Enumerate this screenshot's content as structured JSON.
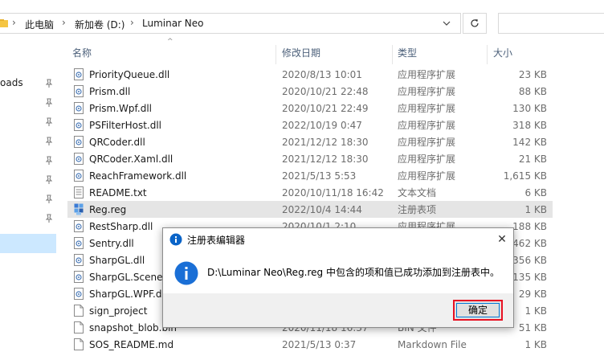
{
  "address": {
    "crumbs": [
      "此电脑",
      "新加卷 (D:)",
      "Luminar Neo"
    ],
    "separator": "›"
  },
  "nav": {
    "partial_label": "oads"
  },
  "columns": {
    "name": "名称",
    "modified": "修改日期",
    "type": "类型",
    "size": "大小"
  },
  "files": [
    {
      "name": "PriorityQueue.dll",
      "modified": "2020/8/13 10:01",
      "type": "应用程序扩展",
      "size": "23 KB",
      "icon": "dll-icon"
    },
    {
      "name": "Prism.dll",
      "modified": "2020/10/21 22:48",
      "type": "应用程序扩展",
      "size": "88 KB",
      "icon": "dll-icon"
    },
    {
      "name": "Prism.Wpf.dll",
      "modified": "2020/10/21 22:49",
      "type": "应用程序扩展",
      "size": "130 KB",
      "icon": "dll-icon"
    },
    {
      "name": "PSFilterHost.dll",
      "modified": "2022/10/19 0:47",
      "type": "应用程序扩展",
      "size": "318 KB",
      "icon": "dll-icon"
    },
    {
      "name": "QRCoder.dll",
      "modified": "2021/12/12 18:30",
      "type": "应用程序扩展",
      "size": "142 KB",
      "icon": "dll-icon"
    },
    {
      "name": "QRCoder.Xaml.dll",
      "modified": "2021/12/12 18:30",
      "type": "应用程序扩展",
      "size": "21 KB",
      "icon": "dll-icon"
    },
    {
      "name": "ReachFramework.dll",
      "modified": "2021/5/13 5:53",
      "type": "应用程序扩展",
      "size": "1,615 KB",
      "icon": "dll-icon"
    },
    {
      "name": "README.txt",
      "modified": "2020/10/11/18 16:42",
      "type": "文本文档",
      "size": "6 KB",
      "icon": "txt-icon"
    },
    {
      "name": "Reg.reg",
      "modified": "2022/10/4 14:44",
      "type": "注册表项",
      "size": "1 KB",
      "icon": "reg-icon",
      "selected": true
    },
    {
      "name": "RestSharp.dll",
      "modified": "2020/10/1 2:10",
      "type": "应用程序扩展",
      "size": "188 KB",
      "icon": "dll-icon"
    },
    {
      "name": "Sentry.dll",
      "modified": "",
      "type": "",
      "size": "462 KB",
      "icon": "dll-icon"
    },
    {
      "name": "SharpGL.dll",
      "modified": "",
      "type": "",
      "size": "356 KB",
      "icon": "dll-icon"
    },
    {
      "name": "SharpGL.SceneG",
      "modified": "",
      "type": "",
      "size": "135 KB",
      "icon": "dll-icon"
    },
    {
      "name": "SharpGL.WPF.dl",
      "modified": "",
      "type": "",
      "size": "29 KB",
      "icon": "dll-icon"
    },
    {
      "name": "sign_project",
      "modified": "",
      "type": "",
      "size": "1 KB",
      "icon": "blank-file-icon"
    },
    {
      "name": "snapshot_blob.bin",
      "modified": "2020/11/18 16:37",
      "type": "BIN 文件",
      "size": "51 KB",
      "icon": "blank-file-icon"
    },
    {
      "name": "SOS_README.md",
      "modified": "2021/5/13 0:37",
      "type": "Markdown File",
      "size": "1 KB",
      "icon": "blank-file-icon"
    }
  ],
  "dialog": {
    "title": "注册表编辑器",
    "close_glyph": "✕",
    "message": "D:\\Luminar Neo\\Reg.reg 中包含的项和值已成功添加到注册表中。",
    "ok_label": "确定"
  },
  "colors": {
    "selected_row": "#e5e5e5",
    "nav_selected": "#cce8ff",
    "accent": "#0078d7",
    "highlight_border": "#e81123"
  }
}
